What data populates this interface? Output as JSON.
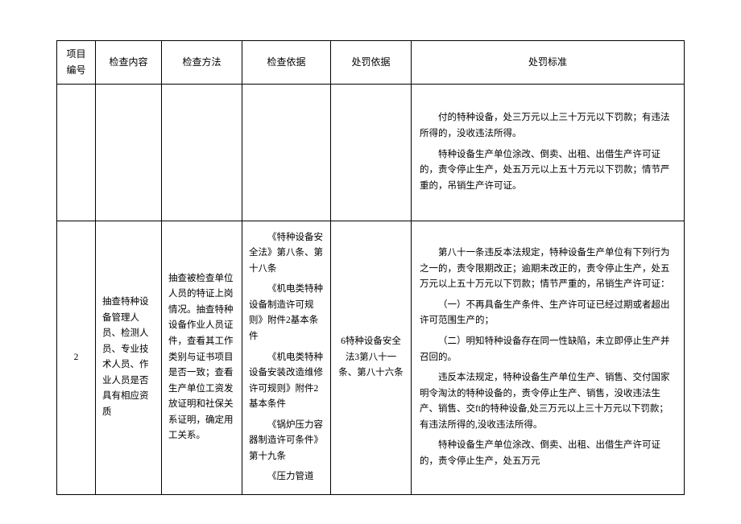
{
  "headers": {
    "no": "项目编号",
    "content": "检查内容",
    "method": "检查方法",
    "basis": "检查依据",
    "penalty_basis": "处罚依据",
    "penalty_std": "处罚标准"
  },
  "rows": [
    {
      "no": "",
      "content": "",
      "method": "",
      "basis": "",
      "penalty_basis": "",
      "std_p1": "付的特种设备，处三万元以上三十万元以下罚款；有违法所得的，没收违法所得。",
      "std_p2": "特种设备生产单位涂改、倒卖、出租、出借生产许可证的，责令停止生产，处五万元以上五十万元以下罚款；情节严重的，吊销生产许可证。"
    },
    {
      "no": "2",
      "content": "抽查特种设备管理人员、检测人员、专业技术人员、作业人员是否具有相应资质",
      "method": "抽查被检查单位人员的特证上岗情况。抽查特种设备作业人员证件，查看其工作类别与证书项目是否一致；查看生产单位工资发放证明和社保关系证明，确定用工关系。",
      "basis_p1": "《特种设备安全法》第八条、第十八条",
      "basis_p2": "《机电类特种设备制造许可规则》附件2基本条件",
      "basis_p3": "《机电类特种设备安装改造维修许可规则》附件2基本条件",
      "basis_p4": "《锅炉压力容器制造许可条件》第十九条",
      "basis_p5": "《压力管道",
      "penalty_basis": "6特种设备安全法3第八十一条、第八十六条",
      "std_p1": "第八十一条违反本法规定，特种设备生产单位有下列行为之一的，责令限期改正；逾期未改正的，责令停止生产，处五万元以上五十万元以下罚款；情节严重的，吊销生产许可证：",
      "std_p2": "（一）不再具备生产条件、生产许可证已经过期或者超出许可范围生产的；",
      "std_p3": "（二）明知特种设备存在同一性缺陷，未立即停止生产并召回的。",
      "std_p4": "违反本法规定，特种设备生产单位生产、销售、交付国家明令淘汰的特种设备的，责令停止生产、销售，没收违法生产、销售、交ft的特种设备,处三万元以上三十万元以下罚款；有违法所得的,没收违法所得。",
      "std_p5": "特种设备生产单位涂改、倒卖、出租、出借生产许可证的，责令停止生产，处五万元"
    }
  ]
}
